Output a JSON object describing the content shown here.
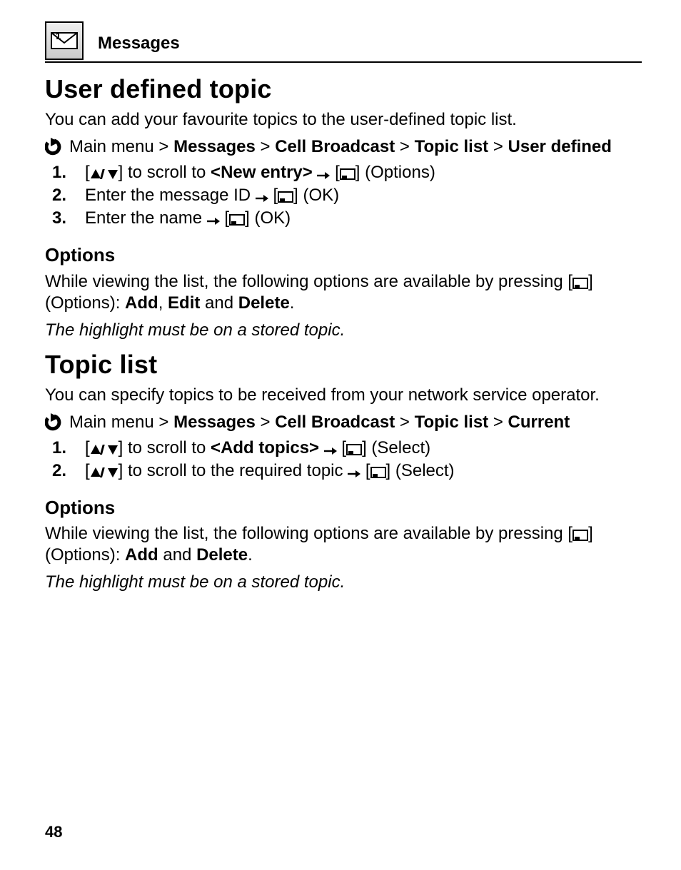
{
  "header": {
    "section": "Messages"
  },
  "udt": {
    "heading": "User defined topic",
    "intro": "You can add your favourite topics to the user-defined topic list.",
    "crumb": {
      "prefix": "Main menu > ",
      "p1": "Messages",
      "sep": " > ",
      "p2": "Cell Broadcast",
      "p3": "Topic list",
      "p4": "User defined"
    },
    "steps": {
      "s1": {
        "num": "1.",
        "a": "[",
        "b": "] to scroll to ",
        "target": "<New entry>",
        "c": " [",
        "d": "] (Options)"
      },
      "s2": {
        "num": "2.",
        "a": "Enter the message ID ",
        "b": " [",
        "c": "] (OK)"
      },
      "s3": {
        "num": "3.",
        "a": "Enter the name ",
        "b": " [",
        "c": "] (OK)"
      }
    },
    "options_heading": "Options",
    "opt_line1a": "While viewing the list, the following options are available by pressing ",
    "opt_line1b": "[",
    "opt_line1c": "] (Options): ",
    "opt_b1": "Add",
    "opt_sep1": ", ",
    "opt_b2": "Edit",
    "opt_sep2": " and ",
    "opt_b3": "Delete",
    "opt_period": ".",
    "opt_note": "The highlight must be on a stored topic."
  },
  "tl": {
    "heading": "Topic list",
    "intro": "You can specify topics to be received from your network service operator.",
    "crumb": {
      "prefix": "Main menu > ",
      "p1": "Messages",
      "sep": " > ",
      "p2": "Cell Broadcast",
      "p3": "Topic list",
      "p4": "Current"
    },
    "steps": {
      "s1": {
        "num": "1.",
        "a": "[",
        "b": "] to scroll to ",
        "target": "<Add topics>",
        "c": " [",
        "d": "] (Select)"
      },
      "s2": {
        "num": "2.",
        "a": "[",
        "b": "] to scroll to the required topic ",
        "c": " [",
        "d": "] (Select)"
      }
    },
    "options_heading": "Options",
    "opt_line1a": "While viewing the list, the following options are available by pressing ",
    "opt_line1b": "[",
    "opt_line1c": "] (Options): ",
    "opt_b1": "Add",
    "opt_sep2": " and ",
    "opt_b3": "Delete",
    "opt_period": ".",
    "opt_note": "The highlight must be on a stored topic."
  },
  "page_number": "48"
}
